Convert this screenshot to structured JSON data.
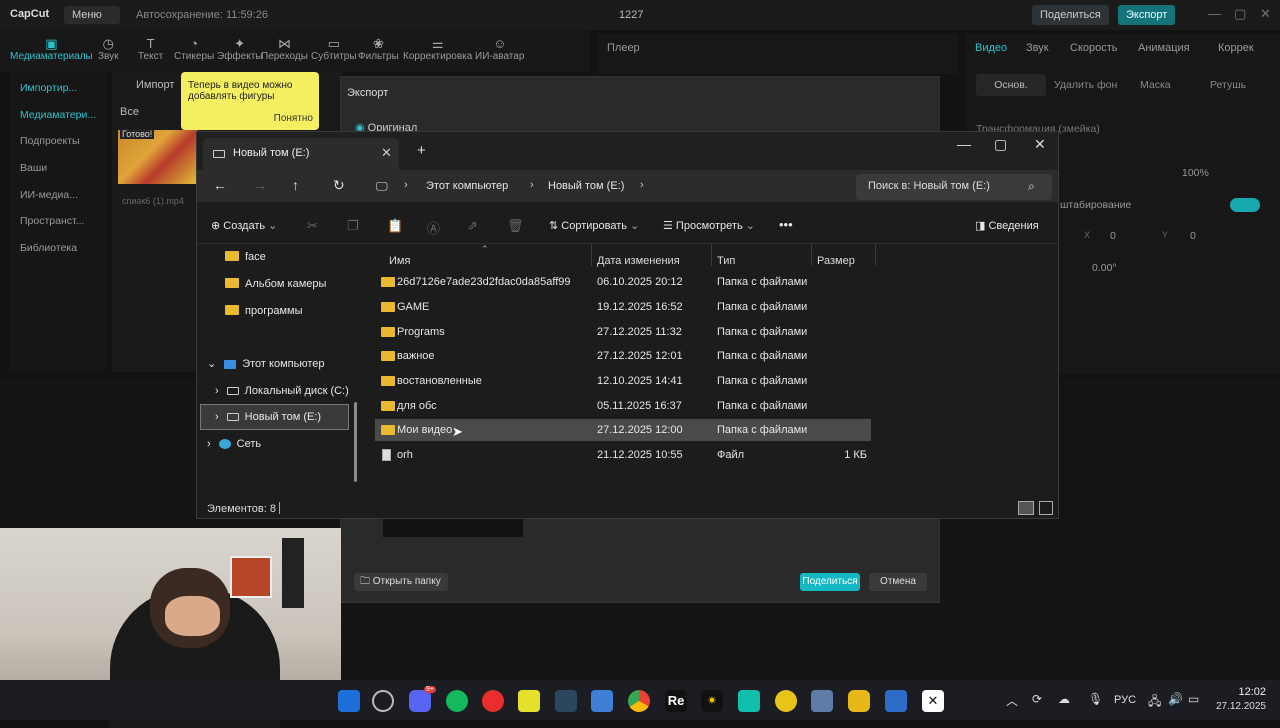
{
  "capcut": {
    "logo": "CapCut",
    "menu": "Меню",
    "autosave": "Автосохранение: 11:59:26",
    "project": "1227",
    "share": "Поделиться",
    "export": "Экспорт",
    "tools": [
      "Медиаматериалы",
      "Звук",
      "Текст",
      "Стикеры",
      "Эффекты",
      "Переходы",
      "Субтитры",
      "Фильтры",
      "Корректировка",
      "ИИ-аватар"
    ],
    "left_items": [
      "Импортир...",
      "Медиаматери...",
      "Подпроекты",
      "Ваши",
      "ИИ-медиа...",
      "Пространст...",
      "Библиотека"
    ],
    "media_tab": "Импорт",
    "media_all": "Все",
    "media_ready": "Готово!",
    "media_filename": "спиак6 (1).mp4",
    "player": "Плеер",
    "right_tabs": [
      "Видео",
      "Звук",
      "Скорость",
      "Анимация",
      "Коррек"
    ],
    "right_subtabs": [
      "Основ.",
      "Удалить фон",
      "Маска",
      "Ретушь"
    ],
    "transform": "Трансформация (змейка)",
    "scale": "100%",
    "scaling": "штабирование",
    "pos_x_label": "X",
    "pos_x": "0",
    "pos_y_label": "Y",
    "pos_y": "0",
    "rotation": "0.00°"
  },
  "tooltip": {
    "text": "Теперь в видео можно добавлять фигуры",
    "ok": "Понятно"
  },
  "export_dialog": {
    "title": "Экспорт",
    "original": "Оригинал",
    "open_folder": "Открыть папку",
    "share": "Поделиться",
    "cancel": "Отмена"
  },
  "explorer": {
    "tab_title": "Новый том (E:)",
    "breadcrumb": [
      "Этот компьютер",
      "Новый том (E:)"
    ],
    "search_placeholder": "Поиск в: Новый том (E:)",
    "commands": {
      "create": "Создать",
      "sort": "Сортировать",
      "view": "Просмотреть",
      "more": "•••",
      "details": "Сведения"
    },
    "sidebar": [
      {
        "label": "face",
        "kind": "folder"
      },
      {
        "label": "Альбом камеры",
        "kind": "folder"
      },
      {
        "label": "программы",
        "kind": "folder"
      },
      {
        "label": "Этот компьютер",
        "kind": "pc"
      },
      {
        "label": "Локальный диск (C:)",
        "kind": "drive"
      },
      {
        "label": "Новый том (E:)",
        "kind": "drive",
        "selected": true
      },
      {
        "label": "Сеть",
        "kind": "network"
      }
    ],
    "columns": {
      "name": "Имя",
      "date": "Дата изменения",
      "type": "Тип",
      "size": "Размер"
    },
    "rows": [
      {
        "name": "26d7126e7ade23d2fdac0da85aff99",
        "date": "06.10.2025 20:12",
        "type": "Папка с файлами",
        "size": "",
        "kind": "folder"
      },
      {
        "name": "GAME",
        "date": "19.12.2025 16:52",
        "type": "Папка с файлами",
        "size": "",
        "kind": "folder"
      },
      {
        "name": "Programs",
        "date": "27.12.2025 11:32",
        "type": "Папка с файлами",
        "size": "",
        "kind": "folder"
      },
      {
        "name": "важное",
        "date": "27.12.2025 12:01",
        "type": "Папка с файлами",
        "size": "",
        "kind": "folder"
      },
      {
        "name": "востановленные",
        "date": "12.10.2025 14:41",
        "type": "Папка с файлами",
        "size": "",
        "kind": "folder"
      },
      {
        "name": "для обс",
        "date": "05.11.2025 16:37",
        "type": "Папка с файлами",
        "size": "",
        "kind": "folder"
      },
      {
        "name": "Мои видео",
        "date": "27.12.2025 12:00",
        "type": "Папка с файлами",
        "size": "",
        "kind": "folder",
        "selected": true
      },
      {
        "name": "orh",
        "date": "21.12.2025 10:55",
        "type": "Файл",
        "size": "1 КБ",
        "kind": "file"
      }
    ],
    "status": "Элементов: 8"
  },
  "taskbar": {
    "lang": "РУС",
    "time": "12:02",
    "date": "27.12.2025",
    "badge": "9+"
  }
}
